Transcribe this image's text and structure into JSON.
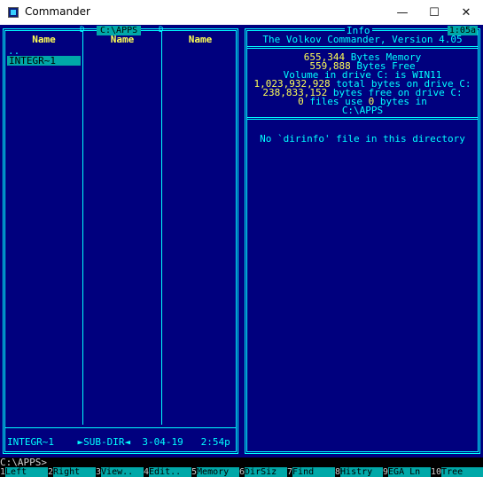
{
  "window": {
    "title": "Commander",
    "minimize": "—",
    "maximize": "☐",
    "close": "✕"
  },
  "left_panel": {
    "path": "C:\\APPS",
    "column_headers": [
      "Name",
      "Name",
      "Name"
    ],
    "entries": [
      "..",
      "INTEGR~1"
    ],
    "selected": "INTEGR~1",
    "status": {
      "name": "INTEGR~1",
      "type": "►SUB-DIR◄",
      "date": "3-04-19",
      "time": "2:54p"
    }
  },
  "info_panel": {
    "title": "Info",
    "clock": "1:05a",
    "heading": "The Volkov Commander, Version 4.05",
    "memory_total": "655,344",
    "memory_total_label": "Bytes Memory",
    "memory_free": "559,888",
    "memory_free_label": "Bytes Free",
    "volume_line": "Volume in drive C: is WIN11",
    "disk_total": "1,023,932,928",
    "disk_total_label": "total bytes on drive C:",
    "disk_free": "238,833,152",
    "disk_free_label": "bytes free on drive C:",
    "files_count": "0",
    "files_mid": "files use",
    "files_bytes": "0",
    "files_tail": "bytes in",
    "files_path": "C:\\APPS",
    "dirinfo_msg": "No `dirinfo' file in this directory"
  },
  "command_line": "C:\\APPS>",
  "function_keys": [
    {
      "num": "1",
      "label": "Left"
    },
    {
      "num": "2",
      "label": "Right"
    },
    {
      "num": "3",
      "label": "View.."
    },
    {
      "num": "4",
      "label": "Edit.."
    },
    {
      "num": "5",
      "label": "Memory"
    },
    {
      "num": "6",
      "label": "DirSiz"
    },
    {
      "num": "7",
      "label": "Find"
    },
    {
      "num": "8",
      "label": "Histry"
    },
    {
      "num": "9",
      "label": "EGA Ln"
    },
    {
      "num": "10",
      "label": "Tree"
    }
  ],
  "colors": {
    "panel_bg": "#00007e",
    "frame": "#00ffff",
    "header_text": "#ffff55",
    "highlight": "#00a8a8"
  }
}
